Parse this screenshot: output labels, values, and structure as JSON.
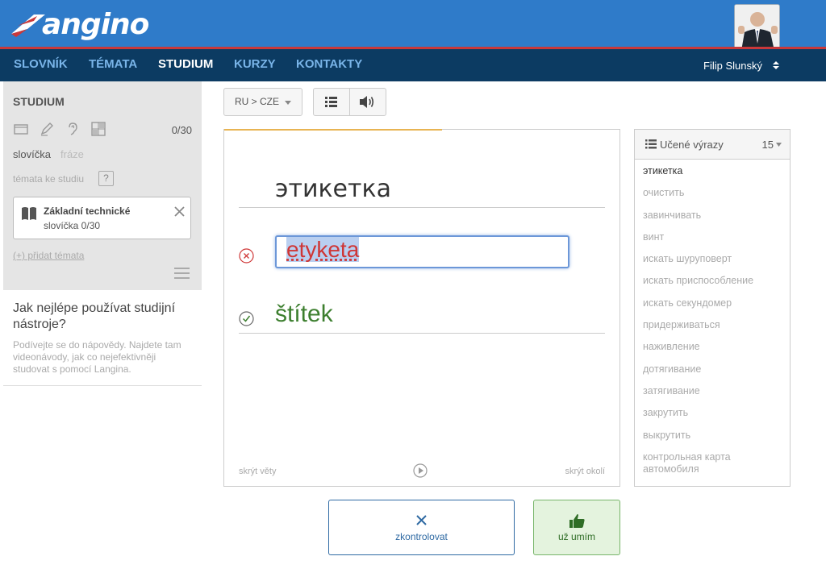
{
  "header": {
    "logo_text": "angino",
    "nav": [
      "SLOVNÍK",
      "TÉMATA",
      "STUDIUM",
      "KURZY",
      "KONTAKTY"
    ],
    "active_nav": "STUDIUM",
    "user_name": "Filip Slunský"
  },
  "sidebar": {
    "title": "STUDIUM",
    "count": "0/30",
    "tab_words": "slovíčka",
    "tab_phrases": "fráze",
    "topics_label": "témata ke studiu",
    "help_mark": "?",
    "topic": {
      "name": "Základní technické",
      "sub": "slovíčka 0/30"
    },
    "add_topic": "(+) přidat témata",
    "help_title": "Jak nejlépe používat studijní nástroje?",
    "help_text": "Podívejte se do nápovědy. Najdete tam videonávody, jak co nejefektivněji studovat s pomocí Langina."
  },
  "toolbar": {
    "lang": "RU > CZE"
  },
  "card": {
    "word": "этикетка",
    "answer": "etyketa",
    "correct": "štítek",
    "hide_sentences": "skrýt věty",
    "hide_context": "skrýt okolí",
    "progress": 0.55
  },
  "wordlist": {
    "title": "Učené výrazy",
    "count": "15",
    "items": [
      "этикетка",
      "очистить",
      "завинчивать",
      "винт",
      "искать шуруповерт",
      "искать приспособление",
      "искать секундомер",
      "придерживаться",
      "наживление",
      "дотягивание",
      "затягивание",
      "закрутить",
      "выкрутить",
      "контрольная карта автомобиля"
    ]
  },
  "actions": {
    "check": "zkontrolovat",
    "know": "už umím"
  },
  "colors": {
    "blue": "#2f7bc9",
    "navy": "#0c3b62",
    "red": "#c9383a",
    "green": "#3d7f2f"
  }
}
